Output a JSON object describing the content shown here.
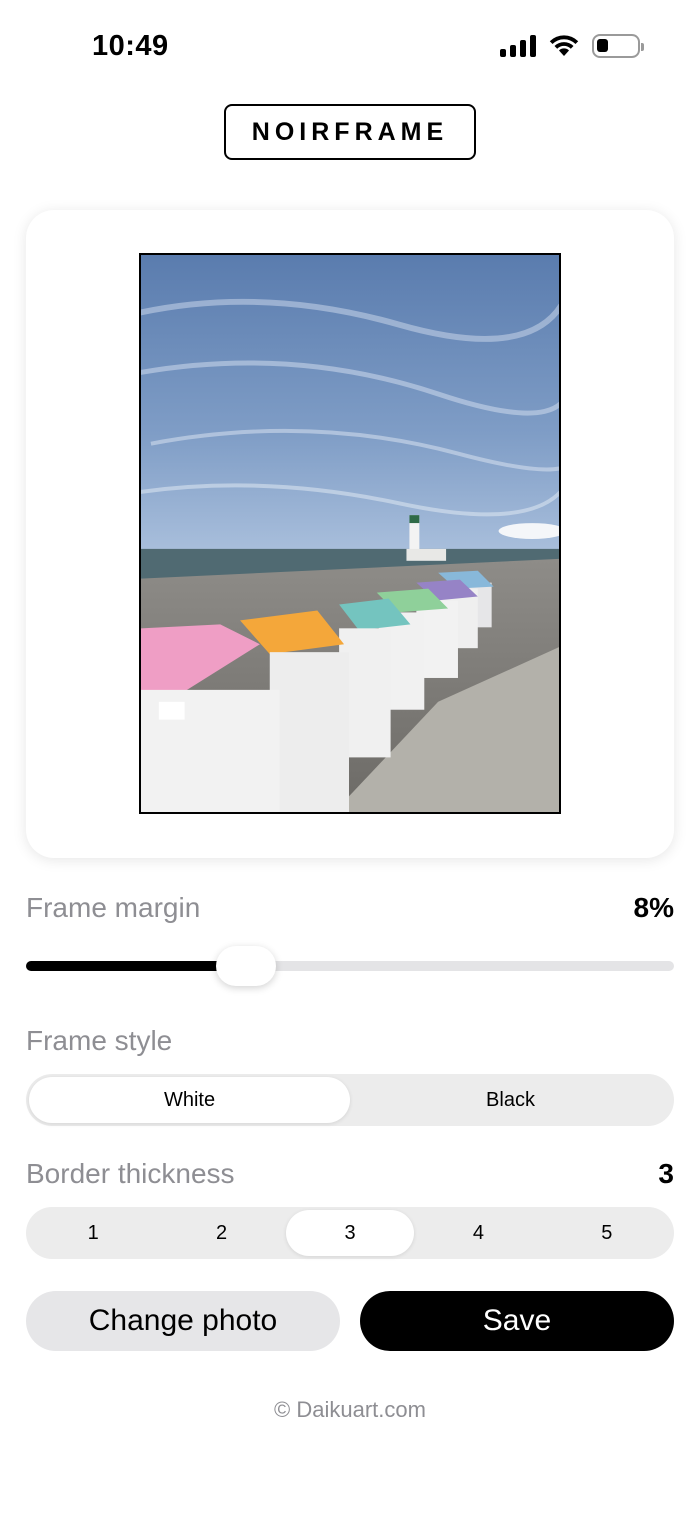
{
  "status_bar": {
    "time": "10:49",
    "signal_icon": "cellular-signal-icon",
    "wifi_icon": "wifi-icon",
    "battery_icon": "battery-icon",
    "battery_level": 0.3
  },
  "header": {
    "logo_text": "NOIRFRAME"
  },
  "preview": {
    "image_subject": "beach huts with pastel roofs and lighthouse"
  },
  "frame_margin": {
    "label": "Frame margin",
    "value_text": "8%",
    "slider_fraction": 0.32
  },
  "frame_style": {
    "label": "Frame style",
    "options": [
      "White",
      "Black"
    ],
    "selected_index": 0
  },
  "border_thickness": {
    "label": "Border thickness",
    "value_text": "3",
    "options": [
      "1",
      "2",
      "3",
      "4",
      "5"
    ],
    "selected_index": 2
  },
  "actions": {
    "change_photo_label": "Change photo",
    "save_label": "Save"
  },
  "footer": {
    "copyright": "© Daikuart.com"
  },
  "colors": {
    "accent": "#000000",
    "muted_text": "#8e8e93",
    "control_bg": "#ececec"
  }
}
